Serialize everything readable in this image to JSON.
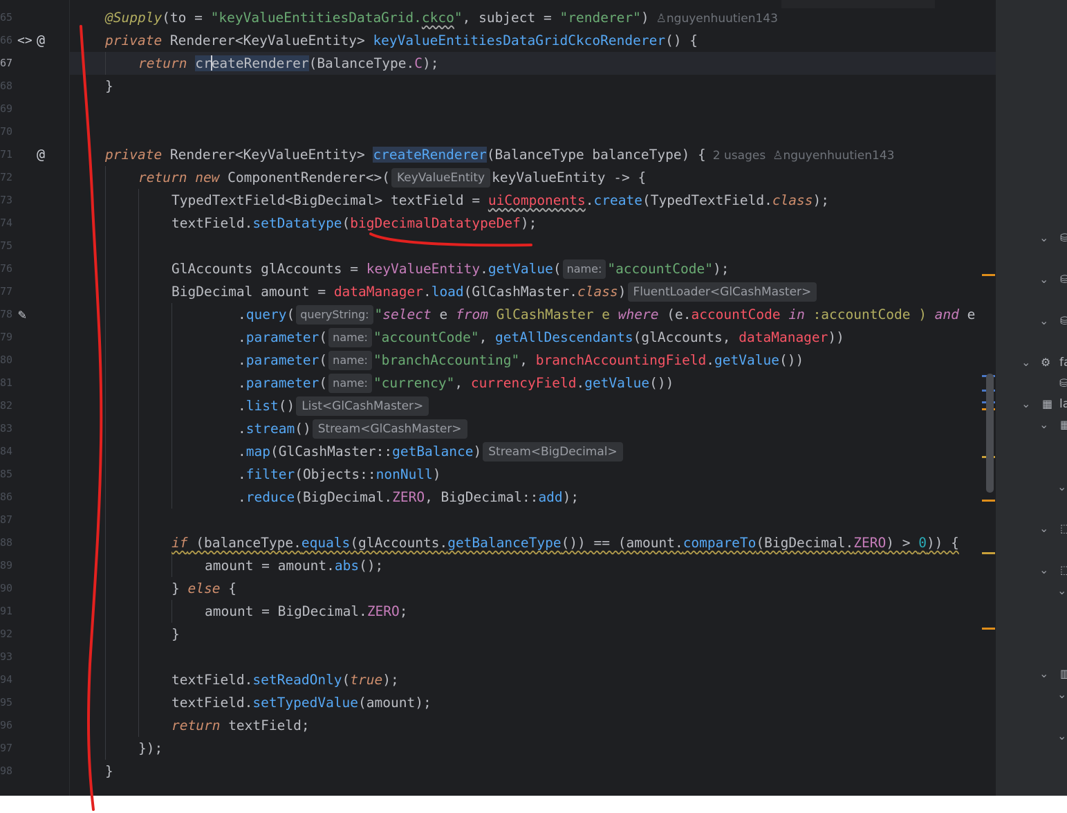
{
  "gutter": {
    "lines": [
      "65",
      "66",
      "67",
      "68",
      "69",
      "70",
      "71",
      "72",
      "73",
      "74",
      "75",
      "76",
      "77",
      "78",
      "79",
      "80",
      "81",
      "82",
      "83",
      "84",
      "85",
      "86",
      "87",
      "88",
      "89",
      "90",
      "91",
      "92",
      "93",
      "94",
      "95",
      "96",
      "97",
      "98"
    ]
  },
  "code": {
    "l65": {
      "ann": "@Supply",
      "p1": "(to = ",
      "s1": "\"keyValueEntitiesDataGrid.",
      "s1w": "ckco",
      "s1e": "\"",
      "p2": ", subject = ",
      "s2": "\"renderer\"",
      "p3": ")",
      "author": "nguyenhuutien143"
    },
    "l66": {
      "kw": "private",
      "t1": " Renderer<KeyValueEntity> ",
      "fn": "keyValueEntitiesDataGridCkcoRenderer",
      "t2": "() {"
    },
    "l67": {
      "kw": "return",
      "t1": " ",
      "fa": "cr",
      "fb": "eateRenderer",
      "t2": "(BalanceType.",
      "f": "C",
      "t3": ");"
    },
    "l68": {
      "t": "}"
    },
    "l71": {
      "kw": "private",
      "t1": " Renderer<KeyValueEntity> ",
      "fn": "createRenderer",
      "t2": "(BalanceType balanceType) {",
      "usages": "2 usages",
      "author": "nguyenhuutien143"
    },
    "l72": {
      "kw1": "return",
      "kw2": "new",
      "t1": " ComponentRenderer<>(",
      "hint": "KeyValueEntity",
      "t2": "keyValueEntity -> {"
    },
    "l73": {
      "t1": "TypedTextField<BigDecimal> textField = ",
      "err": "uiComponents",
      "t2": ".",
      "fn": "create",
      "t3": "(TypedTextField.",
      "kw": "class",
      "t4": ");"
    },
    "l74": {
      "t1": "textField.",
      "fn": "setDatatype",
      "t2": "(",
      "err": "bigDecimalDatatypeDef",
      "t3": ");"
    },
    "l76": {
      "t1": "GlAccounts glAccounts = ",
      "fld": "keyValueEntity",
      "t2": ".",
      "fn": "getValue",
      "t3": "(",
      "hint": "name:",
      "s": "\"accountCode\"",
      "t4": ");"
    },
    "l77": {
      "t1": "BigDecimal amount = ",
      "fld": "dataManager",
      "t2": ".",
      "fn": "load",
      "t3": "(GlCashMaster.",
      "kw": "class",
      "t4": ")",
      "hint": "FluentLoader<GlCashMaster>"
    },
    "l78": {
      "t1": ".",
      "fn": "query",
      "t2": "(",
      "hint": "queryString:",
      "s1": "\"",
      "k1": "select",
      "s2": " e ",
      "k2": "from",
      "s3": " GlCashMaster e ",
      "k3": "where",
      "s4": " (e.",
      "sf": "accountCode",
      "s5": " ",
      "k4": "in",
      "s6": " :accountCode ) ",
      "k5": "and",
      "s7": " e"
    },
    "l79": {
      "t1": ".",
      "fn": "parameter",
      "t2": "(",
      "hint": "name:",
      "s": "\"accountCode\"",
      "t3": ", ",
      "fn2": "getAllDescendants",
      "t4": "(glAccounts, ",
      "err": "dataManager",
      "t5": "))"
    },
    "l80": {
      "t1": ".",
      "fn": "parameter",
      "t2": "(",
      "hint": "name:",
      "s": "\"branchAccounting\"",
      "t3": ", ",
      "err": "branchAccountingField",
      "t4": ".",
      "fn2": "getValue",
      "t5": "())"
    },
    "l81": {
      "t1": ".",
      "fn": "parameter",
      "t2": "(",
      "hint": "name:",
      "s": "\"currency\"",
      "t3": ", ",
      "err": "currencyField",
      "t4": ".",
      "fn2": "getValue",
      "t5": "())"
    },
    "l82": {
      "t1": ".",
      "fn": "list",
      "t2": "()",
      "hint": "List<GlCashMaster>"
    },
    "l83": {
      "t1": ".",
      "fn": "stream",
      "t2": "()",
      "hint": "Stream<GlCashMaster>"
    },
    "l84": {
      "t1": ".",
      "fn": "map",
      "t2": "(GlCashMaster::",
      "fn2": "getBalance",
      "t3": ")",
      "hint": "Stream<BigDecimal>"
    },
    "l85": {
      "t1": ".",
      "fn": "filter",
      "t2": "(Objects::",
      "fn2": "nonNull",
      "t3": ")"
    },
    "l86": {
      "t1": ".",
      "fn": "reduce",
      "t2": "(BigDecimal.",
      "f": "ZERO",
      "t3": ", BigDecimal::",
      "fn2": "add",
      "t4": ");"
    },
    "l88": {
      "kw": "if",
      "t1": " (balanceType.",
      "fn": "equals",
      "t2": "(glAccounts.",
      "fn2": "getBalanceType",
      "t3": "()) == (amount.",
      "fn3": "compareTo",
      "t4": "(BigDecimal.",
      "f": "ZERO",
      "t5": ") > ",
      "n": "0",
      "t6": ")) {"
    },
    "l89": {
      "t1": "amount = amount.",
      "fn": "abs",
      "t2": "();"
    },
    "l90": {
      "t1": "} ",
      "kw": "else",
      "t2": " {"
    },
    "l91": {
      "t1": "amount = BigDecimal.",
      "f": "ZERO",
      "t2": ";"
    },
    "l92": {
      "t": "}"
    },
    "l94": {
      "t1": "textField.",
      "fn": "setReadOnly",
      "t2": "(",
      "kw": "true",
      "t3": ");"
    },
    "l95": {
      "t1": "textField.",
      "fn": "setTypedValue",
      "t2": "(amount);"
    },
    "l96": {
      "kw": "return",
      "t1": " textField;"
    },
    "l97": {
      "t": "});"
    },
    "l98": {
      "t": "}"
    }
  },
  "right_panel": {
    "labels": [
      "fa",
      "la"
    ]
  },
  "icons": {
    "gutter_implement": "implement-arrows-icon",
    "gutter_at": "at-icon",
    "gutter_edit": "pencil-icon",
    "author": "person-icon",
    "panel_db": "database-icon",
    "panel_pkg": "package-icon"
  },
  "colors": {
    "editor_bg": "#1e1f22",
    "keyword": "#cf8e6d",
    "string": "#6aab73",
    "method": "#56a8f5",
    "field": "#c77dbb",
    "error": "#f75464",
    "annotation": "#b3ae60",
    "marker_orange": "#e08e1a",
    "marker_blue": "#4a78c8",
    "pen_red": "#e3211f"
  }
}
